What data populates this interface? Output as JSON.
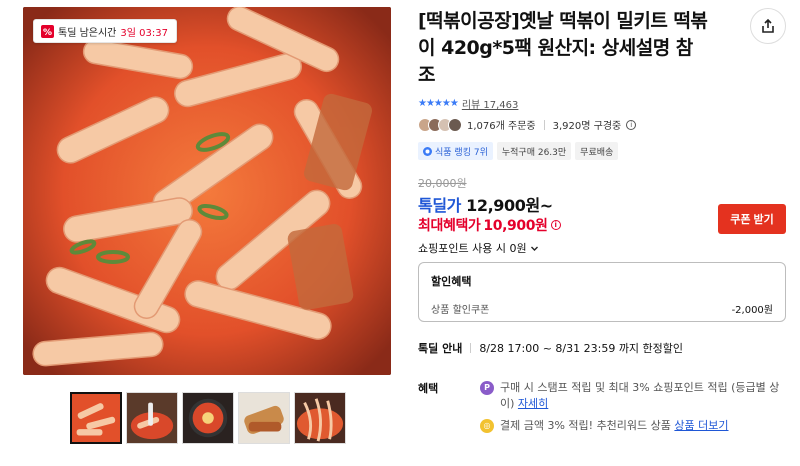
{
  "badge": {
    "label": "톡딜 남은시간",
    "time": "3일 03:37"
  },
  "product": {
    "title": "[떡볶이공장]옛날 떡볶이 밀키트 떡볶이 420g*5팩 원산지: 상세설명 참조",
    "rating_stars": "★★★★★",
    "reviews": "리뷰 17,463",
    "orders": "1,076개 주문중",
    "watchers": "3,920명 구경중",
    "tags": [
      "식품 랭킹 7위",
      "누적구매 26.3만",
      "무료배송"
    ]
  },
  "price": {
    "original": "20,000원",
    "deal_label": "톡딜가",
    "deal_value": "12,900원~",
    "max_label": "최대혜택가",
    "max_value": "10,900원",
    "coupon_button": "쿠폰 받기",
    "point_use": "쇼핑포인트 사용 시 0원"
  },
  "discount_box": {
    "header": "할인혜택",
    "row_label": "상품 할인쿠폰",
    "row_amount": "-2,000원"
  },
  "deal_info": {
    "label": "톡딜 안내",
    "text": "8/28 17:00 ~ 8/31 23:59 까지 한정할인"
  },
  "benefits": {
    "label": "혜택",
    "item1_text": "구매 시 스탬프 적립 및 최대 3% 쇼핑포인트 적립 (등급별 상이)",
    "item1_link": "자세히",
    "item2_text": "결제 금액 3% 적립! 추천리워드 상품",
    "item2_link": "상품 더보기"
  },
  "colors": {
    "accent_blue": "#1f57d6",
    "accent_red": "#e4002b",
    "coupon_red": "#e4321f",
    "star_blue": "#3b7bf6"
  }
}
